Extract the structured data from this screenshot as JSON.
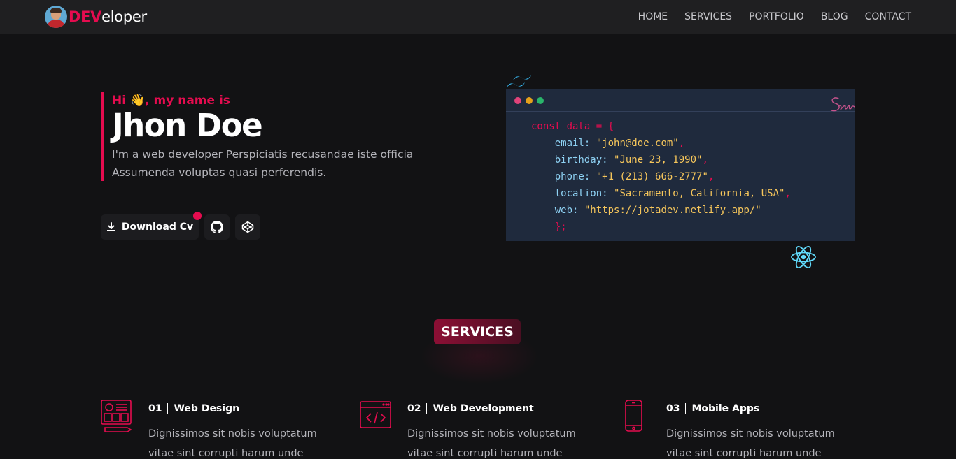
{
  "brand": {
    "accent": "DEV",
    "rest": "eloper"
  },
  "nav": [
    {
      "label": "HOME"
    },
    {
      "label": "SERVICES"
    },
    {
      "label": "PORTFOLIO"
    },
    {
      "label": "BLOG"
    },
    {
      "label": "CONTACT"
    }
  ],
  "hero": {
    "greeting": "Hi 👋, my name is",
    "name": "Jhon Doe",
    "intro": "I'm a web developer Perspiciatis recusandae iste officia Assumenda voluptas quasi perferendis.",
    "download_label": "Download Cv"
  },
  "code": {
    "open": "const data = {",
    "lines": [
      {
        "key": "email",
        "value": "\"john@doe.com\""
      },
      {
        "key": "birthday",
        "value": "\"June 23, 1990\""
      },
      {
        "key": "phone",
        "value": "\"+1 (213) 666-2777\""
      },
      {
        "key": "location",
        "value": "\"Sacramento, California, USA\""
      },
      {
        "key": "web",
        "value": "\"https://jotadev.netlify.app/\""
      }
    ],
    "close": "};"
  },
  "services": {
    "heading": "SERVICES",
    "items": [
      {
        "number": "01",
        "title": "Web Design",
        "desc": "Dignissimos sit nobis voluptatum vitae sint corrupti harum unde"
      },
      {
        "number": "02",
        "title": "Web Development",
        "desc": "Dignissimos sit nobis voluptatum vitae sint corrupti harum unde"
      },
      {
        "number": "03",
        "title": "Mobile Apps",
        "desc": "Dignissimos sit nobis voluptatum vitae sint corrupti harum unde"
      }
    ]
  },
  "icons": {
    "avatar": "avatar",
    "download": "download-icon",
    "github": "github-icon",
    "codepen": "codepen-icon",
    "tailwind": "tailwind-icon",
    "sass": "sass-icon",
    "react": "react-icon"
  },
  "colors": {
    "accent": "#e50c4f",
    "background": "#121214",
    "navbar": "#1f1f21",
    "code_bg": "#1f2a3d",
    "string": "#f6c65b",
    "key": "#8fd3f5"
  }
}
